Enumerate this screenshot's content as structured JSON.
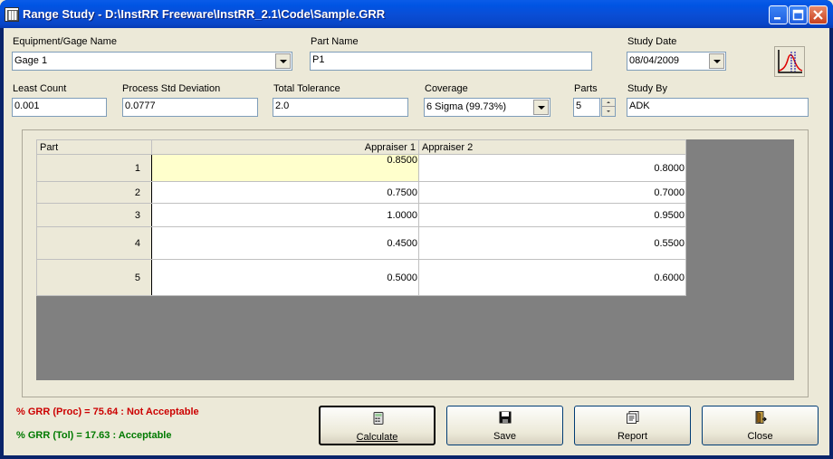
{
  "window": {
    "title": "Range Study - D:\\InstRR Freeware\\InstRR_2.1\\Code\\Sample.GRR"
  },
  "form": {
    "equipment_label": "Equipment/Gage Name",
    "equipment_value": "Gage 1",
    "part_name_label": "Part Name",
    "part_name_value": "P1",
    "study_date_label": "Study Date",
    "study_date_value": "08/04/2009",
    "least_count_label": "Least Count",
    "least_count_value": "0.001",
    "process_sd_label": "Process Std Deviation",
    "process_sd_value": "0.0777",
    "tolerance_label": "Total Tolerance",
    "tolerance_value": "2.0",
    "coverage_label": "Coverage",
    "coverage_value": "6 Sigma (99.73%)",
    "parts_label": "Parts",
    "parts_value": "5",
    "study_by_label": "Study By",
    "study_by_value": "ADK"
  },
  "grid": {
    "headers": [
      "Part",
      "Appraiser 1",
      "Appraiser 2"
    ],
    "rows": [
      {
        "part": "1",
        "a1": "0.8500",
        "a2": "0.8000"
      },
      {
        "part": "2",
        "a1": "0.7500",
        "a2": "0.7000"
      },
      {
        "part": "3",
        "a1": "1.0000",
        "a2": "0.9500"
      },
      {
        "part": "4",
        "a1": "0.4500",
        "a2": "0.5500"
      },
      {
        "part": "5",
        "a1": "0.5000",
        "a2": "0.6000"
      }
    ]
  },
  "results": {
    "grr_proc": "% GRR (Proc) = 75.64 : Not Acceptable",
    "grr_proc_color": "#cc0000",
    "grr_tol": "% GRR (Tol) = 17.63 : Acceptable",
    "grr_tol_color": "#007a00"
  },
  "buttons": {
    "calculate": "Calculate",
    "save": "Save",
    "report": "Report",
    "close": "Close"
  },
  "icons": {
    "app": "app-icon",
    "chart": "chart-icon",
    "calculate": "calculator-icon",
    "save": "floppy-disk-icon",
    "report": "report-icon",
    "close": "exit-door-icon"
  }
}
